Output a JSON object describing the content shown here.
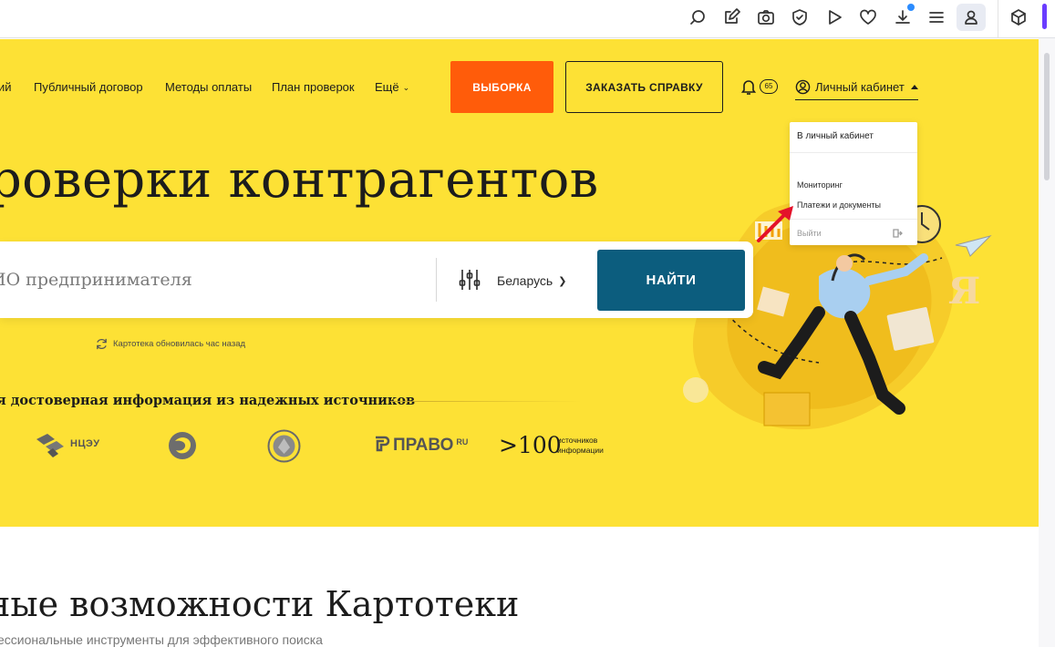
{
  "browser": {
    "toolbar_icons": [
      "search-page-icon",
      "edit-icon",
      "camera-icon",
      "shield-icon",
      "play-icon",
      "heart-icon",
      "download-icon",
      "menu-icon",
      "profile-icon",
      "cube-icon"
    ],
    "accent": "#6a3cff"
  },
  "nav": {
    "items": [
      "ий",
      "Публичный договор",
      "Методы оплаты",
      "План проверок",
      "Ещё"
    ]
  },
  "header": {
    "vyborka_label": "ВЫБОРКА",
    "order_label": "ЗАКАЗАТЬ СПРАВКУ",
    "notifications_count": "65",
    "cabinet_label": "Личный кабинет"
  },
  "dropdown": {
    "head": "В личный кабинет",
    "items": [
      "Мониторинг",
      "Платежи и документы"
    ],
    "logout": "Выйти"
  },
  "hero": {
    "headline": "роверки контрагентов",
    "search_placeholder": "ИО предпринимателя",
    "country": "Беларусь",
    "find_label": "НАЙТИ",
    "updated_text": "Картотека обновилась час назад"
  },
  "sources": {
    "title": "я достоверная информация из надежных источников",
    "ncze_label": "НЦЭУ",
    "pravo_label": "ПРАВО",
    "pravo_sup": "RU",
    "count": ">100",
    "count_caption": "источников информации"
  },
  "section": {
    "title": "ные возможности Картотеки",
    "subtitle": "ессиональные инструменты для эффективного поиска"
  },
  "colors": {
    "hero_bg": "#fde135",
    "orange": "#ff5c0a",
    "button_dark": "#0c5d7e"
  }
}
